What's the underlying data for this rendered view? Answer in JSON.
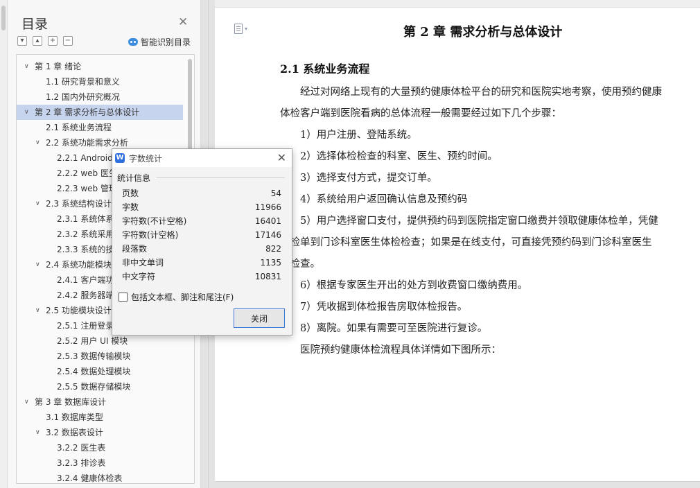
{
  "toc": {
    "title": "目录",
    "smart_label": "智能识别目录",
    "tools": [
      "▾",
      "▴",
      "+",
      "−"
    ],
    "items": [
      {
        "text": "第 1 章  绪论",
        "level": 0,
        "expanded": true,
        "selected": false
      },
      {
        "text": "1.1  研究背景和意义",
        "level": 1
      },
      {
        "text": "1.2  国内外研究概况",
        "level": 1
      },
      {
        "text": "第 2 章  需求分析与总体设计",
        "level": 0,
        "expanded": true,
        "selected": true
      },
      {
        "text": "2.1  系统业务流程",
        "level": 1
      },
      {
        "text": "2.2  系统功能需求分析",
        "level": 1,
        "expanded": true
      },
      {
        "text": "2.2.1 Android 客户端",
        "level": 2
      },
      {
        "text": "2.2.2 web 医生端",
        "level": 2
      },
      {
        "text": "2.2.3 web 管理端",
        "level": 2
      },
      {
        "text": "2.3  系统结构设计",
        "level": 1,
        "expanded": true
      },
      {
        "text": "2.3.1  系统体系结构",
        "level": 2
      },
      {
        "text": "2.3.2  系统采用技术",
        "level": 2
      },
      {
        "text": "2.3.3  系统的技术架构",
        "level": 2
      },
      {
        "text": "2.4  系统功能模块",
        "level": 1,
        "expanded": true
      },
      {
        "text": "2.4.1  客户端功能模块",
        "level": 2
      },
      {
        "text": "2.4.2  服务器端功能模块",
        "level": 2
      },
      {
        "text": "2.5  功能模块设计",
        "level": 1,
        "expanded": true
      },
      {
        "text": "2.5.1  注册登录模块",
        "level": 2
      },
      {
        "text": "2.5.2  用户 UI 模块",
        "level": 2
      },
      {
        "text": "2.5.3  数据传输模块",
        "level": 2
      },
      {
        "text": "2.5.4  数据处理模块",
        "level": 2
      },
      {
        "text": "2.5.5  数据存储模块",
        "level": 2
      },
      {
        "text": "第 3 章  数据库设计",
        "level": 0,
        "expanded": true
      },
      {
        "text": "3.1  数据库类型",
        "level": 1
      },
      {
        "text": "3.2  数据表设计",
        "level": 1,
        "expanded": true
      },
      {
        "text": "3.2.2  医生表",
        "level": 2
      },
      {
        "text": "3.2.3  排诊表",
        "level": 2
      },
      {
        "text": "3.2.4  健康体检表",
        "level": 2
      }
    ]
  },
  "document": {
    "chapter_title": "第 2 章  需求分析与总体设计",
    "section_title": "2.1  系统业务流程",
    "lines": [
      "　　经过对网络上现有的大量预约健康体检平台的研究和医院实地考察，使用预约健康",
      "体检客户端到医院看病的总体流程一般需要经过如下几个步骤：",
      "　　1）用户注册、登陆系统。",
      "　　2）选择体检检查的科室、医生、预约时间。",
      "　　3）选择支付方式，提交订单。",
      "　　4）系统给用户返回确认信息及预约码",
      "　　5）用户选择窗口支付，提供预约码到医院指定窗口缴费并领取健康体检单，凭健",
      "体检单到门诊科室医生体检检查；如果是在线支付，可直接凭预约码到门诊科室医生",
      "检检查。",
      "　　6）根据专家医生开出的处方到收费窗口缴纳费用。",
      "　　7）凭收据到体检报告房取体检报告。",
      "　　8）离院。如果有需要可至医院进行复诊。",
      "　　医院预约健康体检流程具体详情如下图所示："
    ]
  },
  "dialog": {
    "title": "字数统计",
    "section": "统计信息",
    "stats": [
      {
        "label": "页数",
        "value": "54"
      },
      {
        "label": "字数",
        "value": "11966"
      },
      {
        "label": "字符数(不计空格)",
        "value": "16401"
      },
      {
        "label": "字符数(计空格)",
        "value": "17146"
      },
      {
        "label": "段落数",
        "value": "822"
      },
      {
        "label": "非中文单词",
        "value": "1135"
      },
      {
        "label": "中文字符",
        "value": "10831"
      }
    ],
    "checkbox_label": "包括文本框、脚注和尾注(F)",
    "checkbox_checked": false,
    "close_button": "关闭"
  }
}
